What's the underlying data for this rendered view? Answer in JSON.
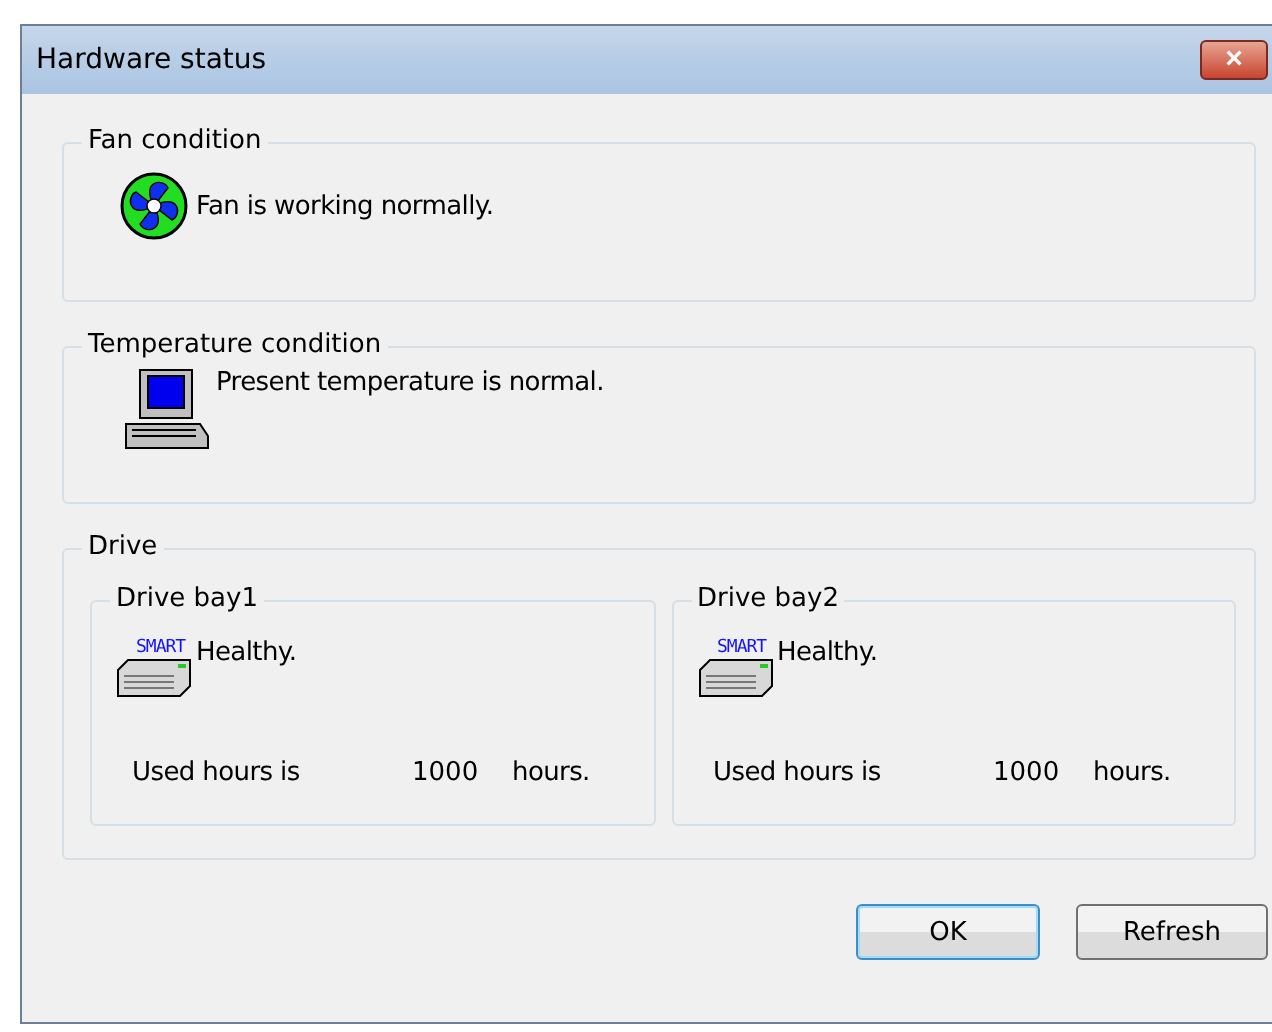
{
  "window": {
    "title": "Hardware status",
    "close": "×"
  },
  "fan": {
    "title": "Fan condition",
    "message": "Fan is working normally."
  },
  "temperature": {
    "title": "Temperature condition",
    "message": "Present temperature is normal."
  },
  "drive": {
    "title": "Drive",
    "bays": [
      {
        "title": "Drive bay1",
        "icon_label": "SMART",
        "status": "Healthy.",
        "hours_label": "Used hours is",
        "hours": "1000",
        "unit": "hours."
      },
      {
        "title": "Drive bay2",
        "icon_label": "SMART",
        "status": "Healthy.",
        "hours_label": "Used hours is",
        "hours": "1000",
        "unit": "hours."
      }
    ]
  },
  "buttons": [
    {
      "label": "OK",
      "default": true
    },
    {
      "label": "Refresh",
      "default": false
    }
  ]
}
